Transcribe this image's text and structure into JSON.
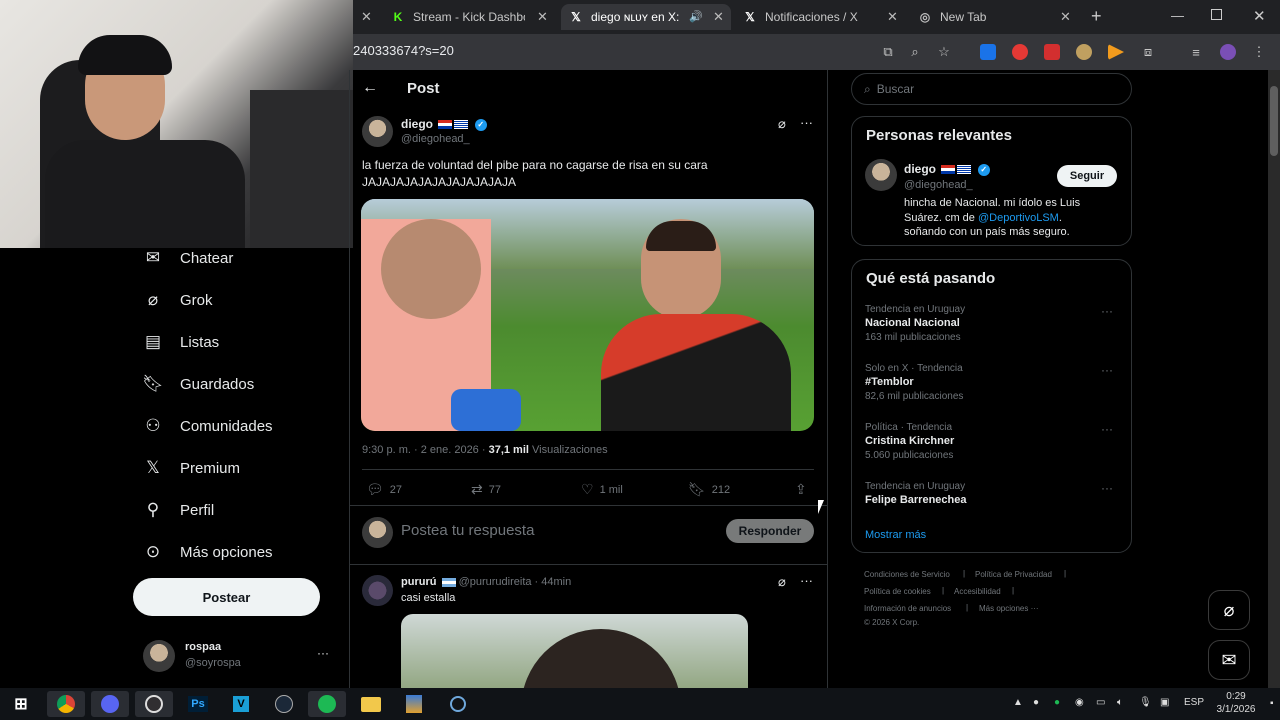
{
  "browser": {
    "tabs": [
      {
        "title": "Stream - Kick Dashboard",
        "icon": "kick-icon"
      },
      {
        "title": "diego ɴʟᴜʏ en X: \"la",
        "icon": "x-logo-icon"
      },
      {
        "title": "Notificaciones / X",
        "icon": "x-logo-icon"
      },
      {
        "title": "New Tab",
        "icon": "globe-icon"
      }
    ],
    "url": "240333674?s=20"
  },
  "nav": {
    "items": [
      {
        "label": "Chatear",
        "icon": "envelope-icon"
      },
      {
        "label": "Grok",
        "icon": "grok-icon"
      },
      {
        "label": "Listas",
        "icon": "list-icon"
      },
      {
        "label": "Guardados",
        "icon": "bookmark-icon"
      },
      {
        "label": "Comunidades",
        "icon": "people-icon"
      },
      {
        "label": "Premium",
        "icon": "x-logo-icon"
      },
      {
        "label": "Perfil",
        "icon": "person-icon"
      },
      {
        "label": "Más opciones",
        "icon": "more-circle-icon"
      }
    ],
    "post_button": "Postear",
    "account": {
      "name": "rospaa",
      "handle": "@soyrospa"
    }
  },
  "post": {
    "header_title": "Post",
    "author_name": "diego",
    "author_handle": "@diegohead_",
    "text_line1": "la fuerza de voluntad del pibe para no cagarse de risa en su cara",
    "text_line2": "JAJAJAJAJAJAJAJAJAJAJA",
    "time": "9:30 p. m. · 2 ene. 2026 ·",
    "views_count": "37,1 mil",
    "views_label": "Visualizaciones",
    "replies": "27",
    "reposts": "77",
    "likes": "1 mil",
    "bookmarks": "212",
    "reply_placeholder": "Postea tu respuesta",
    "reply_button": "Responder"
  },
  "reply": {
    "name": "pururú",
    "handle_time": "@pururudireita · 44min",
    "text": "casi estalla"
  },
  "search": {
    "placeholder": "Buscar"
  },
  "relevant": {
    "title": "Personas relevantes",
    "name": "diego",
    "handle": "@diegohead_",
    "follow": "Seguir",
    "bio1": "hincha de Nacional. mi ídolo es Luis",
    "bio2": "Suárez. cm de",
    "bio_link": "@DeportivoLSM",
    "bio3": ".",
    "bio4": "soñando con un país más seguro."
  },
  "trending": {
    "title": "Qué está pasando",
    "items": [
      {
        "meta": "Tendencia en Uruguay",
        "name": "Nacional Nacional",
        "count": "163 mil publicaciones"
      },
      {
        "meta": "Solo en X · Tendencia",
        "name": "#Temblor",
        "count": "82,6 mil publicaciones"
      },
      {
        "meta": "Política · Tendencia",
        "name": "Cristina Kirchner",
        "count": "5.060 publicaciones"
      },
      {
        "meta": "Tendencia en Uruguay",
        "name": "Felipe Barrenechea",
        "count": ""
      }
    ],
    "show_more": "Mostrar más"
  },
  "footer": {
    "links": [
      "Condiciones de Servicio",
      "Política de Privacidad",
      "Política de cookies",
      "Accesibilidad",
      "Información de anuncios",
      "Más opciones ···"
    ],
    "copyright": "© 2026 X Corp."
  },
  "taskbar": {
    "lang": "ESP",
    "time": "0:29",
    "date": "3/1/2026"
  },
  "colors": {
    "accent": "#1d9bf0",
    "background": "#000000",
    "border": "#2f3336"
  }
}
